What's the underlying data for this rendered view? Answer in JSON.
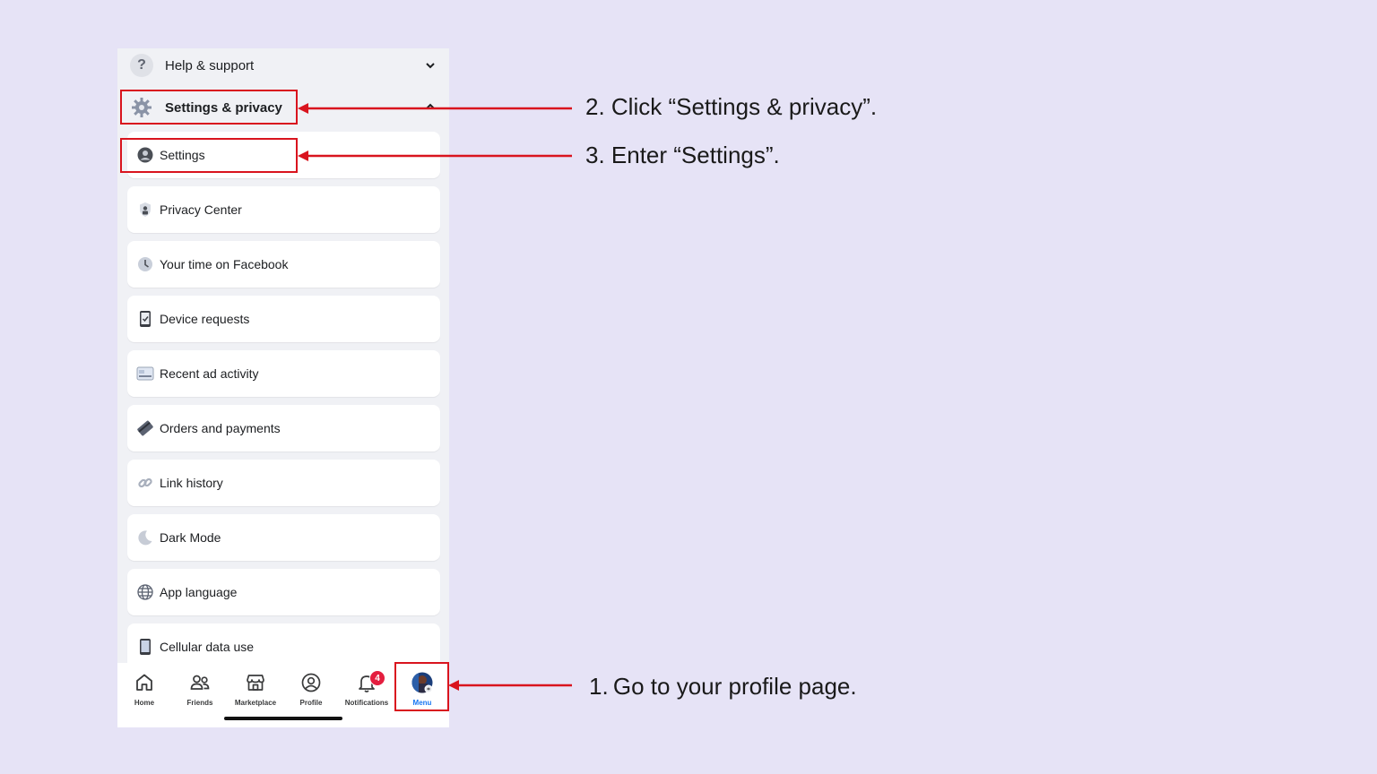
{
  "menu": {
    "help_support": {
      "label": "Help & support",
      "icon": "question-icon",
      "chevron": "chevron-down"
    },
    "settings_privacy": {
      "label": "Settings & privacy",
      "icon": "gear-icon",
      "chevron": "chevron-up"
    },
    "items": [
      {
        "label": "Settings",
        "icon": "person-circle-icon"
      },
      {
        "label": "Privacy Center",
        "icon": "lock-person-icon"
      },
      {
        "label": "Your time on Facebook",
        "icon": "clock-icon"
      },
      {
        "label": "Device requests",
        "icon": "phone-check-icon"
      },
      {
        "label": "Recent ad activity",
        "icon": "ad-activity-icon"
      },
      {
        "label": "Orders and payments",
        "icon": "card-icon"
      },
      {
        "label": "Link history",
        "icon": "link-icon"
      },
      {
        "label": "Dark Mode",
        "icon": "moon-icon"
      },
      {
        "label": "App language",
        "icon": "globe-icon"
      },
      {
        "label": "Cellular data use",
        "icon": "phone-icon"
      }
    ]
  },
  "tabbar": {
    "tabs": [
      {
        "label": "Home",
        "icon": "home-icon"
      },
      {
        "label": "Friends",
        "icon": "friends-icon"
      },
      {
        "label": "Marketplace",
        "icon": "marketplace-icon"
      },
      {
        "label": "Profile",
        "icon": "profile-icon"
      },
      {
        "label": "Notifications",
        "icon": "bell-icon",
        "badge": "4"
      },
      {
        "label": "Menu",
        "icon": "avatar",
        "active": true
      }
    ]
  },
  "annotations": {
    "step1": "1. Go to your profile page.",
    "step2": "2. Click “Settings & privacy”.",
    "step3": "3. Enter “Settings”."
  },
  "colors": {
    "background": "#e6e3f6",
    "highlight": "#d9141e",
    "active_tab": "#1877f2"
  }
}
